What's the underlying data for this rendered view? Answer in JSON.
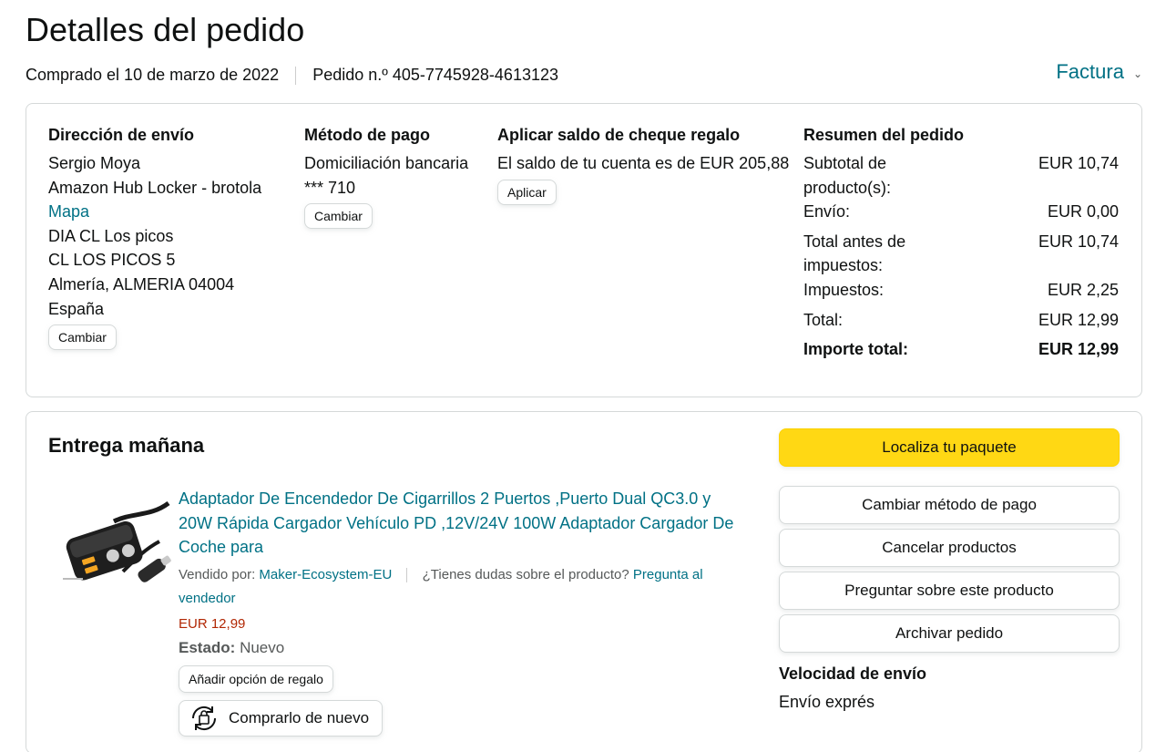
{
  "page": {
    "title": "Detalles del pedido",
    "ordered_on": "Comprado el 10 de marzo de 2022",
    "order_number": "Pedido n.º 405-7745928-4613123",
    "invoice_label": "Factura"
  },
  "shipping_address": {
    "heading": "Dirección de envío",
    "name": "Sergio Moya",
    "locker": "Amazon Hub Locker - brotola",
    "map_link": "Mapa",
    "line1": "DIA CL Los picos",
    "line2": "CL LOS PICOS 5",
    "city": "Almería, ALMERIA 04004",
    "country": "España",
    "change_label": "Cambiar"
  },
  "payment": {
    "heading": "Método de pago",
    "method": "Domiciliación bancaria",
    "account": "*** 710",
    "change_label": "Cambiar"
  },
  "gift_card": {
    "heading": "Aplicar saldo de cheque regalo",
    "balance_text": "El saldo de tu cuenta es de EUR 205,88",
    "apply_label": "Aplicar"
  },
  "order_summary": {
    "heading": "Resumen del pedido",
    "rows": [
      {
        "label": "Subtotal de producto(s):",
        "value": "EUR 10,74"
      },
      {
        "label": "Envío:",
        "value": "EUR 0,00"
      },
      {
        "label": "Total antes de impuestos:",
        "value": "EUR 10,74"
      },
      {
        "label": "Impuestos:",
        "value": "EUR 2,25"
      },
      {
        "label": "Total:",
        "value": "EUR 12,99"
      }
    ],
    "grand_total_label": "Importe total:",
    "grand_total_value": "EUR 12,99"
  },
  "delivery": {
    "heading": "Entrega mañana",
    "product": {
      "title": "Adaptador De Encendedor De Cigarrillos 2 Puertos ,Puerto Dual QC3.0 y 20W Rápida Cargador Vehículo PD ,12V/24V 100W Adaptador Cargador De Coche para",
      "sold_by_label": "Vendido por:",
      "seller": "Maker-Ecosystem-EU",
      "question_text": "¿Tienes dudas sobre el producto?",
      "ask_seller": "Pregunta al vendedor",
      "price": "EUR 12,99",
      "condition_label": "Estado:",
      "condition_value": "Nuevo",
      "gift_option_label": "Añadir opción de regalo",
      "buy_again_label": "Comprarlo de nuevo"
    },
    "actions": {
      "track": "Localiza tu paquete",
      "change_payment": "Cambiar método de pago",
      "cancel": "Cancelar productos",
      "ask": "Preguntar sobre este producto",
      "archive": "Archivar pedido"
    },
    "shipping_speed_heading": "Velocidad de envío",
    "shipping_speed_value": "Envío exprés"
  },
  "colors": {
    "link": "#007185",
    "primary_button": "#FFD814",
    "price": "#B12704",
    "border": "#D5D9D9"
  }
}
